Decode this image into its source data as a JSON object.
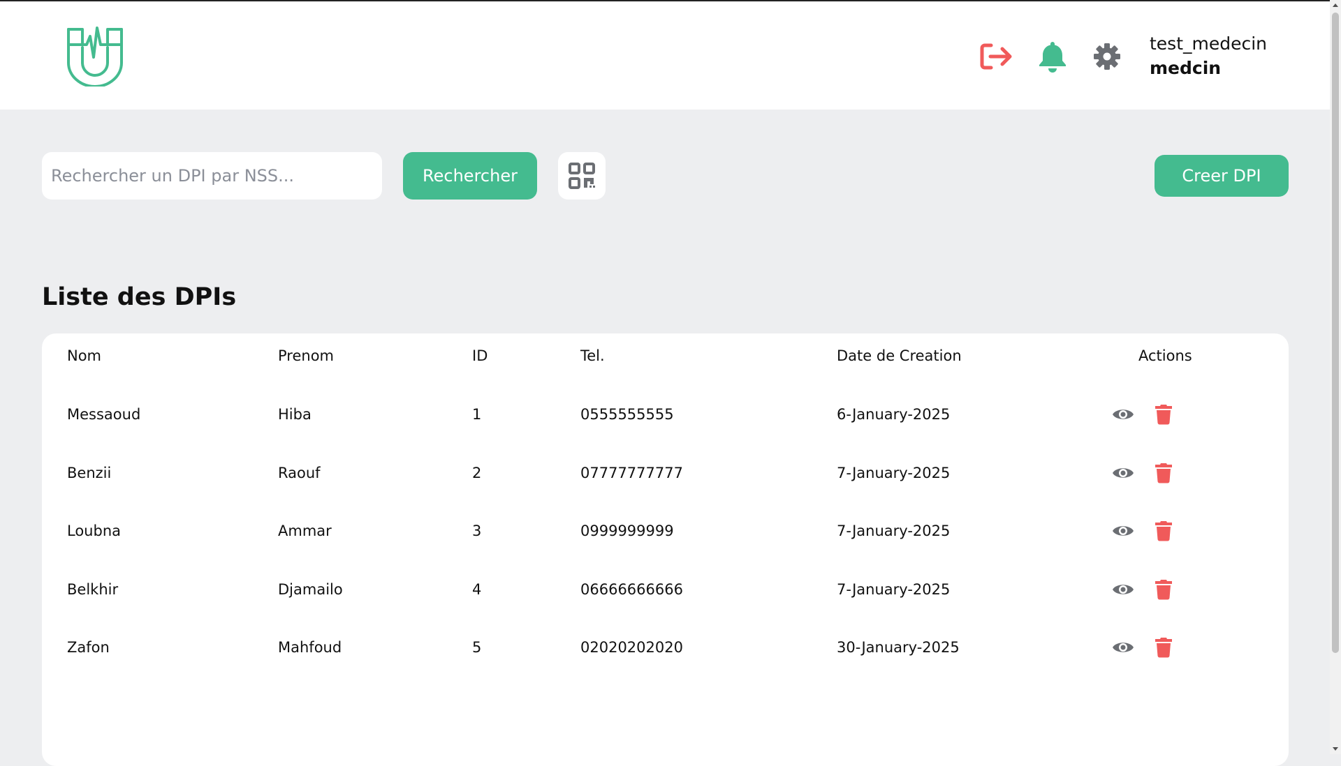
{
  "header": {
    "user_name": "test_medecin",
    "user_role": "medcin",
    "icons": {
      "logo": "stethoscope-u-logo",
      "logout": "logout-icon",
      "notifications": "bell-icon",
      "settings": "gear-icon"
    }
  },
  "colors": {
    "accent": "#44bb8f",
    "danger": "#f05a5a",
    "icon_gray": "#6b6e73",
    "background": "#edeef0"
  },
  "search": {
    "placeholder": "Rechercher un DPI par NSS...",
    "value": "",
    "button_label": "Rechercher",
    "qr_icon": "qr-code-icon"
  },
  "create_button_label": "Creer DPI",
  "list": {
    "title": "Liste des DPIs",
    "columns": [
      "Nom",
      "Prenom",
      "ID",
      "Tel.",
      "Date de Creation",
      "Actions"
    ],
    "rows": [
      {
        "nom": "Messaoud",
        "prenom": "Hiba",
        "id": "1",
        "tel": "0555555555",
        "date": "6-January-2025"
      },
      {
        "nom": "Benzii",
        "prenom": "Raouf",
        "id": "2",
        "tel": "07777777777",
        "date": "7-January-2025"
      },
      {
        "nom": "Loubna",
        "prenom": "Ammar",
        "id": "3",
        "tel": "0999999999",
        "date": "7-January-2025"
      },
      {
        "nom": "Belkhir",
        "prenom": "Djamailo",
        "id": "4",
        "tel": "06666666666",
        "date": "7-January-2025"
      },
      {
        "nom": "Zafon",
        "prenom": "Mahfoud",
        "id": "5",
        "tel": "02020202020",
        "date": "30-January-2025"
      }
    ],
    "row_action_icons": [
      "eye-icon",
      "trash-icon"
    ]
  }
}
